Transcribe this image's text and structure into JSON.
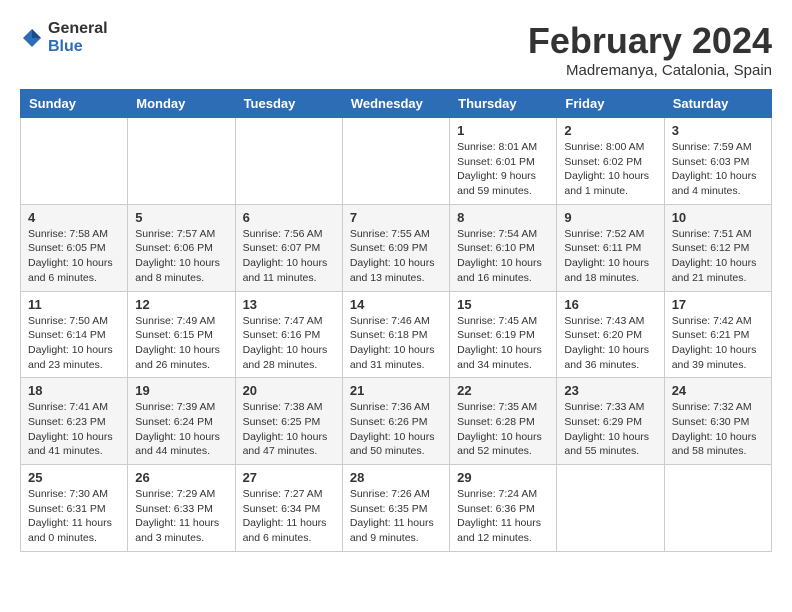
{
  "header": {
    "logo_general": "General",
    "logo_blue": "Blue",
    "month_title": "February 2024",
    "subtitle": "Madremanya, Catalonia, Spain"
  },
  "days_of_week": [
    "Sunday",
    "Monday",
    "Tuesday",
    "Wednesday",
    "Thursday",
    "Friday",
    "Saturday"
  ],
  "weeks": [
    [
      {
        "day": "",
        "info": ""
      },
      {
        "day": "",
        "info": ""
      },
      {
        "day": "",
        "info": ""
      },
      {
        "day": "",
        "info": ""
      },
      {
        "day": "1",
        "info": "Sunrise: 8:01 AM\nSunset: 6:01 PM\nDaylight: 9 hours and 59 minutes."
      },
      {
        "day": "2",
        "info": "Sunrise: 8:00 AM\nSunset: 6:02 PM\nDaylight: 10 hours and 1 minute."
      },
      {
        "day": "3",
        "info": "Sunrise: 7:59 AM\nSunset: 6:03 PM\nDaylight: 10 hours and 4 minutes."
      }
    ],
    [
      {
        "day": "4",
        "info": "Sunrise: 7:58 AM\nSunset: 6:05 PM\nDaylight: 10 hours and 6 minutes."
      },
      {
        "day": "5",
        "info": "Sunrise: 7:57 AM\nSunset: 6:06 PM\nDaylight: 10 hours and 8 minutes."
      },
      {
        "day": "6",
        "info": "Sunrise: 7:56 AM\nSunset: 6:07 PM\nDaylight: 10 hours and 11 minutes."
      },
      {
        "day": "7",
        "info": "Sunrise: 7:55 AM\nSunset: 6:09 PM\nDaylight: 10 hours and 13 minutes."
      },
      {
        "day": "8",
        "info": "Sunrise: 7:54 AM\nSunset: 6:10 PM\nDaylight: 10 hours and 16 minutes."
      },
      {
        "day": "9",
        "info": "Sunrise: 7:52 AM\nSunset: 6:11 PM\nDaylight: 10 hours and 18 minutes."
      },
      {
        "day": "10",
        "info": "Sunrise: 7:51 AM\nSunset: 6:12 PM\nDaylight: 10 hours and 21 minutes."
      }
    ],
    [
      {
        "day": "11",
        "info": "Sunrise: 7:50 AM\nSunset: 6:14 PM\nDaylight: 10 hours and 23 minutes."
      },
      {
        "day": "12",
        "info": "Sunrise: 7:49 AM\nSunset: 6:15 PM\nDaylight: 10 hours and 26 minutes."
      },
      {
        "day": "13",
        "info": "Sunrise: 7:47 AM\nSunset: 6:16 PM\nDaylight: 10 hours and 28 minutes."
      },
      {
        "day": "14",
        "info": "Sunrise: 7:46 AM\nSunset: 6:18 PM\nDaylight: 10 hours and 31 minutes."
      },
      {
        "day": "15",
        "info": "Sunrise: 7:45 AM\nSunset: 6:19 PM\nDaylight: 10 hours and 34 minutes."
      },
      {
        "day": "16",
        "info": "Sunrise: 7:43 AM\nSunset: 6:20 PM\nDaylight: 10 hours and 36 minutes."
      },
      {
        "day": "17",
        "info": "Sunrise: 7:42 AM\nSunset: 6:21 PM\nDaylight: 10 hours and 39 minutes."
      }
    ],
    [
      {
        "day": "18",
        "info": "Sunrise: 7:41 AM\nSunset: 6:23 PM\nDaylight: 10 hours and 41 minutes."
      },
      {
        "day": "19",
        "info": "Sunrise: 7:39 AM\nSunset: 6:24 PM\nDaylight: 10 hours and 44 minutes."
      },
      {
        "day": "20",
        "info": "Sunrise: 7:38 AM\nSunset: 6:25 PM\nDaylight: 10 hours and 47 minutes."
      },
      {
        "day": "21",
        "info": "Sunrise: 7:36 AM\nSunset: 6:26 PM\nDaylight: 10 hours and 50 minutes."
      },
      {
        "day": "22",
        "info": "Sunrise: 7:35 AM\nSunset: 6:28 PM\nDaylight: 10 hours and 52 minutes."
      },
      {
        "day": "23",
        "info": "Sunrise: 7:33 AM\nSunset: 6:29 PM\nDaylight: 10 hours and 55 minutes."
      },
      {
        "day": "24",
        "info": "Sunrise: 7:32 AM\nSunset: 6:30 PM\nDaylight: 10 hours and 58 minutes."
      }
    ],
    [
      {
        "day": "25",
        "info": "Sunrise: 7:30 AM\nSunset: 6:31 PM\nDaylight: 11 hours and 0 minutes."
      },
      {
        "day": "26",
        "info": "Sunrise: 7:29 AM\nSunset: 6:33 PM\nDaylight: 11 hours and 3 minutes."
      },
      {
        "day": "27",
        "info": "Sunrise: 7:27 AM\nSunset: 6:34 PM\nDaylight: 11 hours and 6 minutes."
      },
      {
        "day": "28",
        "info": "Sunrise: 7:26 AM\nSunset: 6:35 PM\nDaylight: 11 hours and 9 minutes."
      },
      {
        "day": "29",
        "info": "Sunrise: 7:24 AM\nSunset: 6:36 PM\nDaylight: 11 hours and 12 minutes."
      },
      {
        "day": "",
        "info": ""
      },
      {
        "day": "",
        "info": ""
      }
    ]
  ]
}
